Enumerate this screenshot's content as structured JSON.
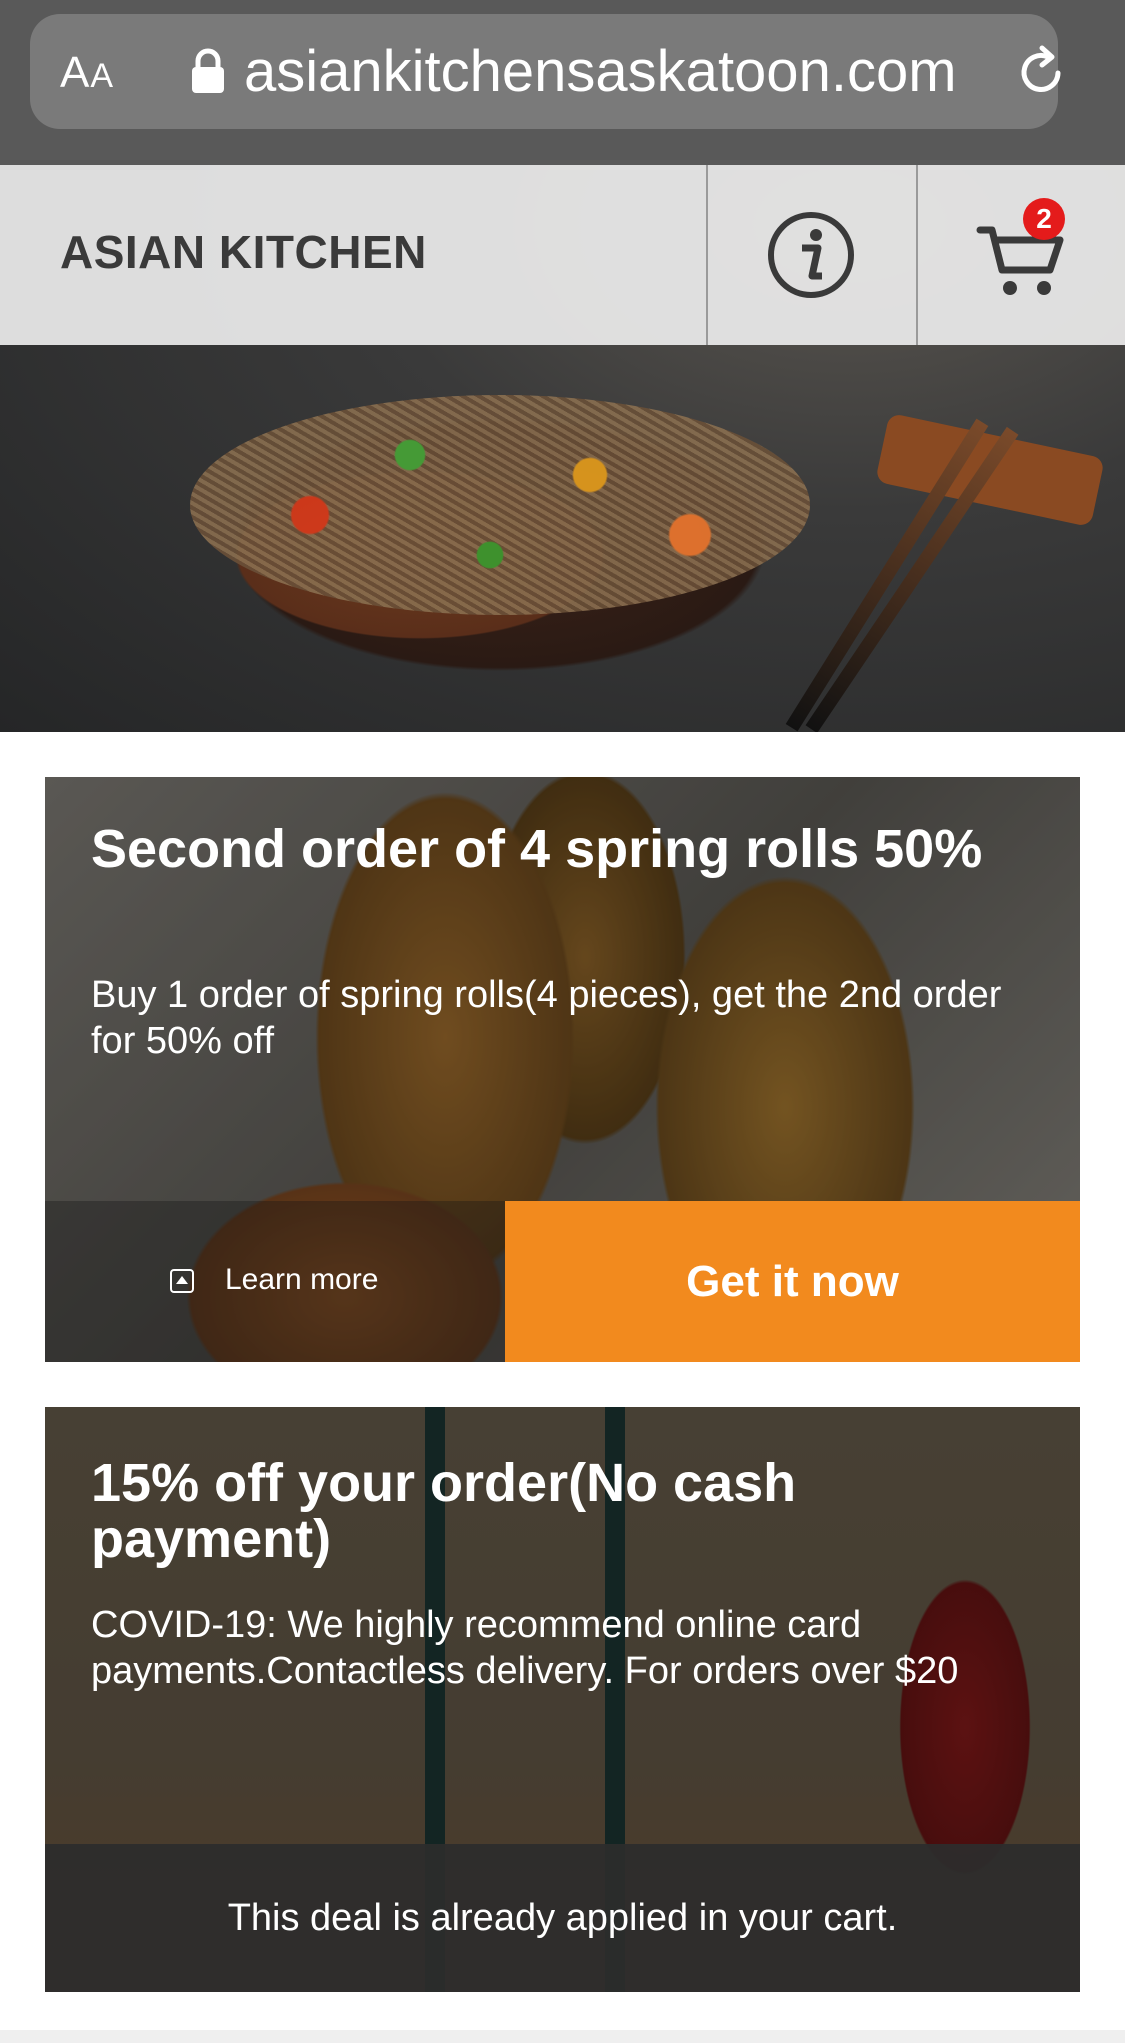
{
  "browser": {
    "aa_label": "AA",
    "url": "asiankitchensaskatoon.com"
  },
  "header": {
    "brand": "ASIAN KITCHEN",
    "cart_count": "2"
  },
  "colors": {
    "accent": "#f28a1e",
    "badge": "#e41b1b"
  },
  "deals": [
    {
      "title": "Second order of 4 spring rolls 50%",
      "description": "Buy 1 order of spring rolls(4 pieces), get the 2nd order for 50% off",
      "learn_more": "Learn more",
      "cta": "Get it now"
    },
    {
      "title": "15% off your order(No cash payment)",
      "description": "COVID-19: We highly recommend online card payments.Contactless delivery. For orders over $20",
      "status": "This deal is already applied in your cart."
    }
  ]
}
